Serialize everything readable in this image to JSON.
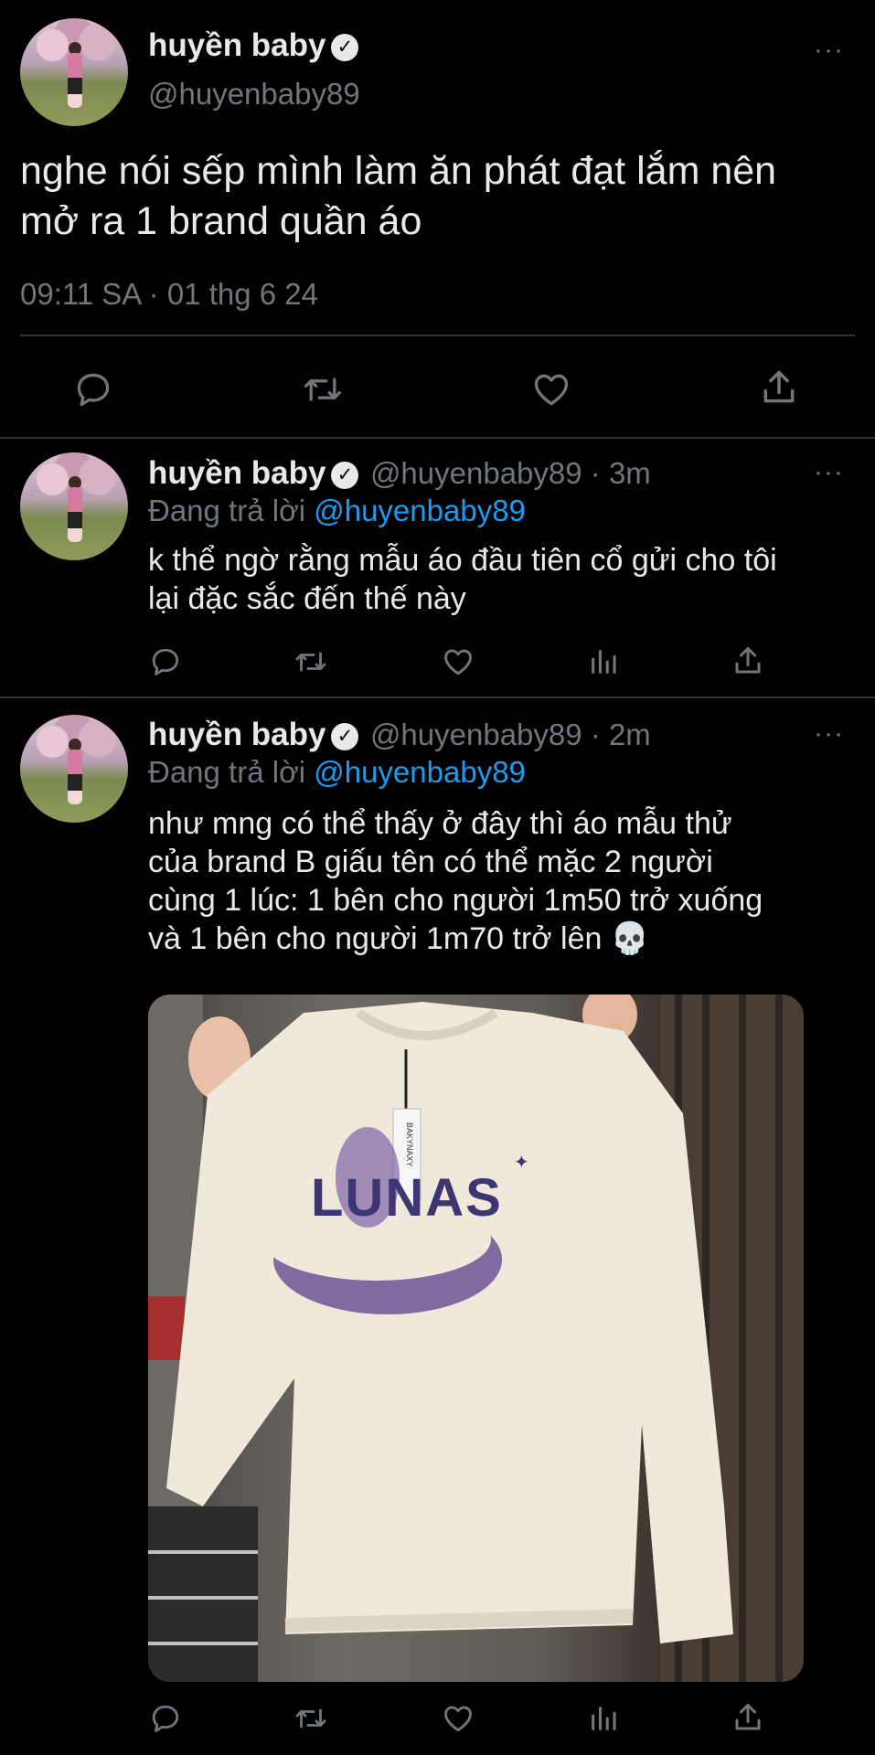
{
  "main_tweet": {
    "display_name": "huyền baby",
    "handle": "@huyenbaby89",
    "text_line1": "nghe nói sếp mình làm ăn phát đạt lắm nên",
    "text_line2": "mở ra 1 brand quần áo",
    "timestamp": "09:11 SA · 01 thg 6 24"
  },
  "replies": [
    {
      "display_name": "huyền baby",
      "handle_time": "@huyenbaby89 · 3m",
      "replying_to_label": "Đang trả lời",
      "replying_to_handle": "@huyenbaby89",
      "text_lines": [
        "k thể ngờ rằng mẫu áo đầu tiên cổ gửi cho tôi",
        "lại đặc sắc đến thế này"
      ]
    },
    {
      "display_name": "huyền baby",
      "handle_time": "@huyenbaby89 · 2m",
      "replying_to_label": "Đang trả lời",
      "replying_to_handle": "@huyenbaby89",
      "text_lines": [
        "như mng có thể thấy ở đây thì áo mẫu thử",
        "của brand B giấu tên có thể mặc 2 người",
        "cùng 1 lúc: 1 bên cho người 1m50 trở xuống",
        "và 1 bên cho người 1m70 trở lên 💀"
      ],
      "media": {
        "description": "photo of a cream sweatshirt held up",
        "print_text": "LUNAS",
        "tag_text": "BAKYNAXY"
      }
    }
  ],
  "icons": {
    "verified": "✓",
    "more": "···",
    "reply": "reply-icon",
    "retweet": "retweet-icon",
    "like": "like-icon",
    "views": "views-icon",
    "share": "share-icon"
  },
  "colors": {
    "background": "#000000",
    "text": "#e7e9ea",
    "muted": "#71767b",
    "link": "#1d9bf0",
    "divider": "#2f3336"
  }
}
